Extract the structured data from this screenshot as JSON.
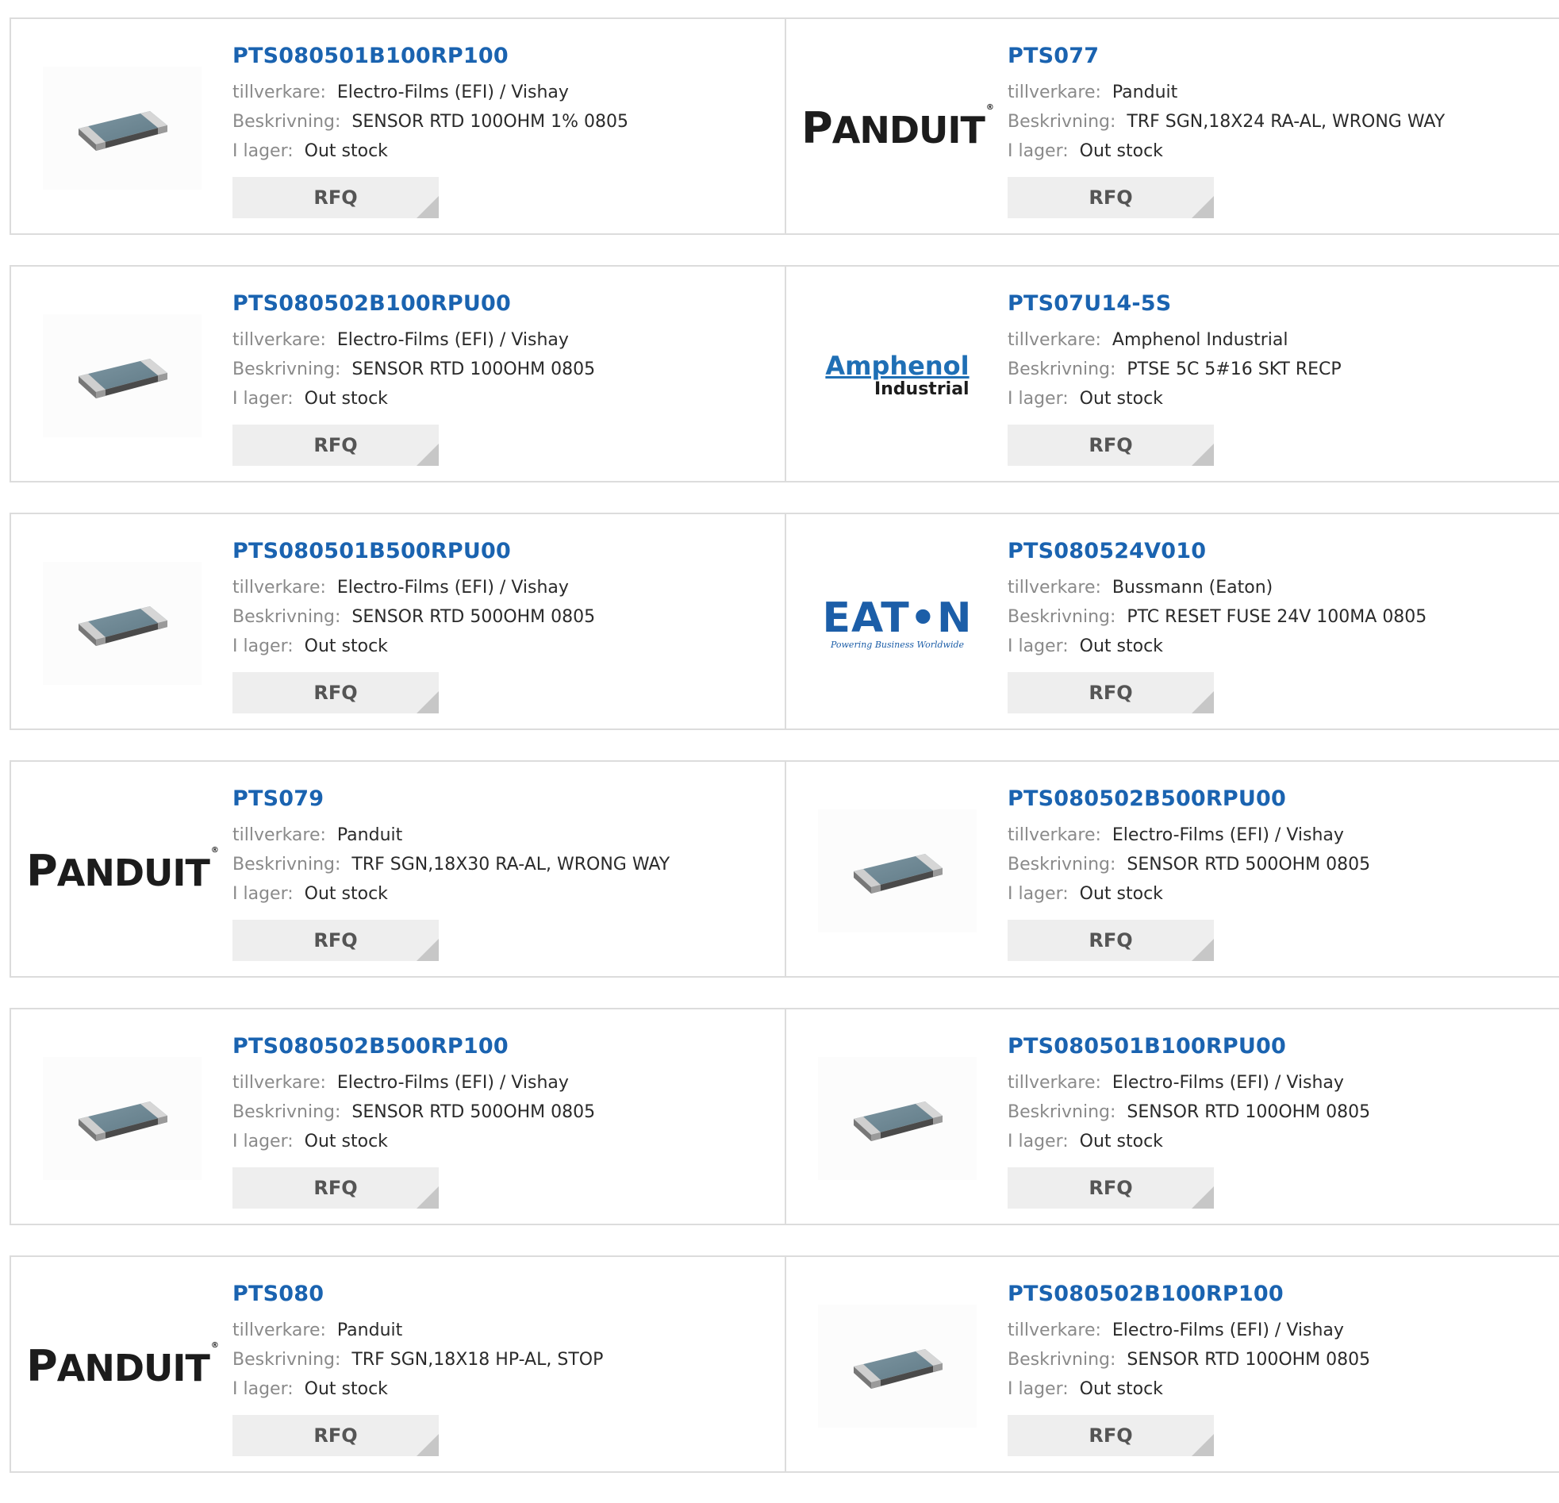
{
  "labels": {
    "manufacturer": "tillverkare:",
    "description": "Beskrivning:",
    "stock": "I lager:",
    "rfq": "RFQ"
  },
  "logos": {
    "panduit": "PANDUIT",
    "amphenol_brand": "Amphenol",
    "amphenol_sub": "Industrial",
    "eaton_brand": "EAT•N",
    "eaton_tagline": "Powering Business Worldwide"
  },
  "colors": {
    "part_link": "#1a63b0",
    "label_gray": "#8a8a8a",
    "rfq_bg": "#eeeeee",
    "border": "#dcdcdc"
  },
  "products": [
    {
      "part": "PTS080501B100RP100",
      "manufacturer": "Electro-Films (EFI) / Vishay",
      "description": "SENSOR RTD 100OHM 1% 0805",
      "stock": "Out stock",
      "image": "chip-resistor"
    },
    {
      "part": "PTS077",
      "manufacturer": "Panduit",
      "description": "TRF SGN,18X24 RA-AL, WRONG WAY",
      "stock": "Out stock",
      "image": "panduit-logo"
    },
    {
      "part": "PTS080502B100RPU00",
      "manufacturer": "Electro-Films (EFI) / Vishay",
      "description": "SENSOR RTD 100OHM 0805",
      "stock": "Out stock",
      "image": "chip-resistor"
    },
    {
      "part": "PTS07U14-5S",
      "manufacturer": "Amphenol Industrial",
      "description": "PTSE 5C 5#16 SKT RECP",
      "stock": "Out stock",
      "image": "amphenol-logo"
    },
    {
      "part": "PTS080501B500RPU00",
      "manufacturer": "Electro-Films (EFI) / Vishay",
      "description": "SENSOR RTD 500OHM 0805",
      "stock": "Out stock",
      "image": "chip-resistor"
    },
    {
      "part": "PTS080524V010",
      "manufacturer": "Bussmann (Eaton)",
      "description": "PTC RESET FUSE 24V 100MA 0805",
      "stock": "Out stock",
      "image": "eaton-logo"
    },
    {
      "part": "PTS079",
      "manufacturer": "Panduit",
      "description": "TRF SGN,18X30 RA-AL, WRONG WAY",
      "stock": "Out stock",
      "image": "panduit-logo"
    },
    {
      "part": "PTS080502B500RPU00",
      "manufacturer": "Electro-Films (EFI) / Vishay",
      "description": "SENSOR RTD 500OHM 0805",
      "stock": "Out stock",
      "image": "chip-resistor"
    },
    {
      "part": "PTS080502B500RP100",
      "manufacturer": "Electro-Films (EFI) / Vishay",
      "description": "SENSOR RTD 500OHM 0805",
      "stock": "Out stock",
      "image": "chip-resistor"
    },
    {
      "part": "PTS080501B100RPU00",
      "manufacturer": "Electro-Films (EFI) / Vishay",
      "description": "SENSOR RTD 100OHM 0805",
      "stock": "Out stock",
      "image": "chip-resistor"
    },
    {
      "part": "PTS080",
      "manufacturer": "Panduit",
      "description": "TRF SGN,18X18 HP-AL, STOP",
      "stock": "Out stock",
      "image": "panduit-logo"
    },
    {
      "part": "PTS080502B100RP100",
      "manufacturer": "Electro-Films (EFI) / Vishay",
      "description": "SENSOR RTD 100OHM 0805",
      "stock": "Out stock",
      "image": "chip-resistor"
    }
  ]
}
